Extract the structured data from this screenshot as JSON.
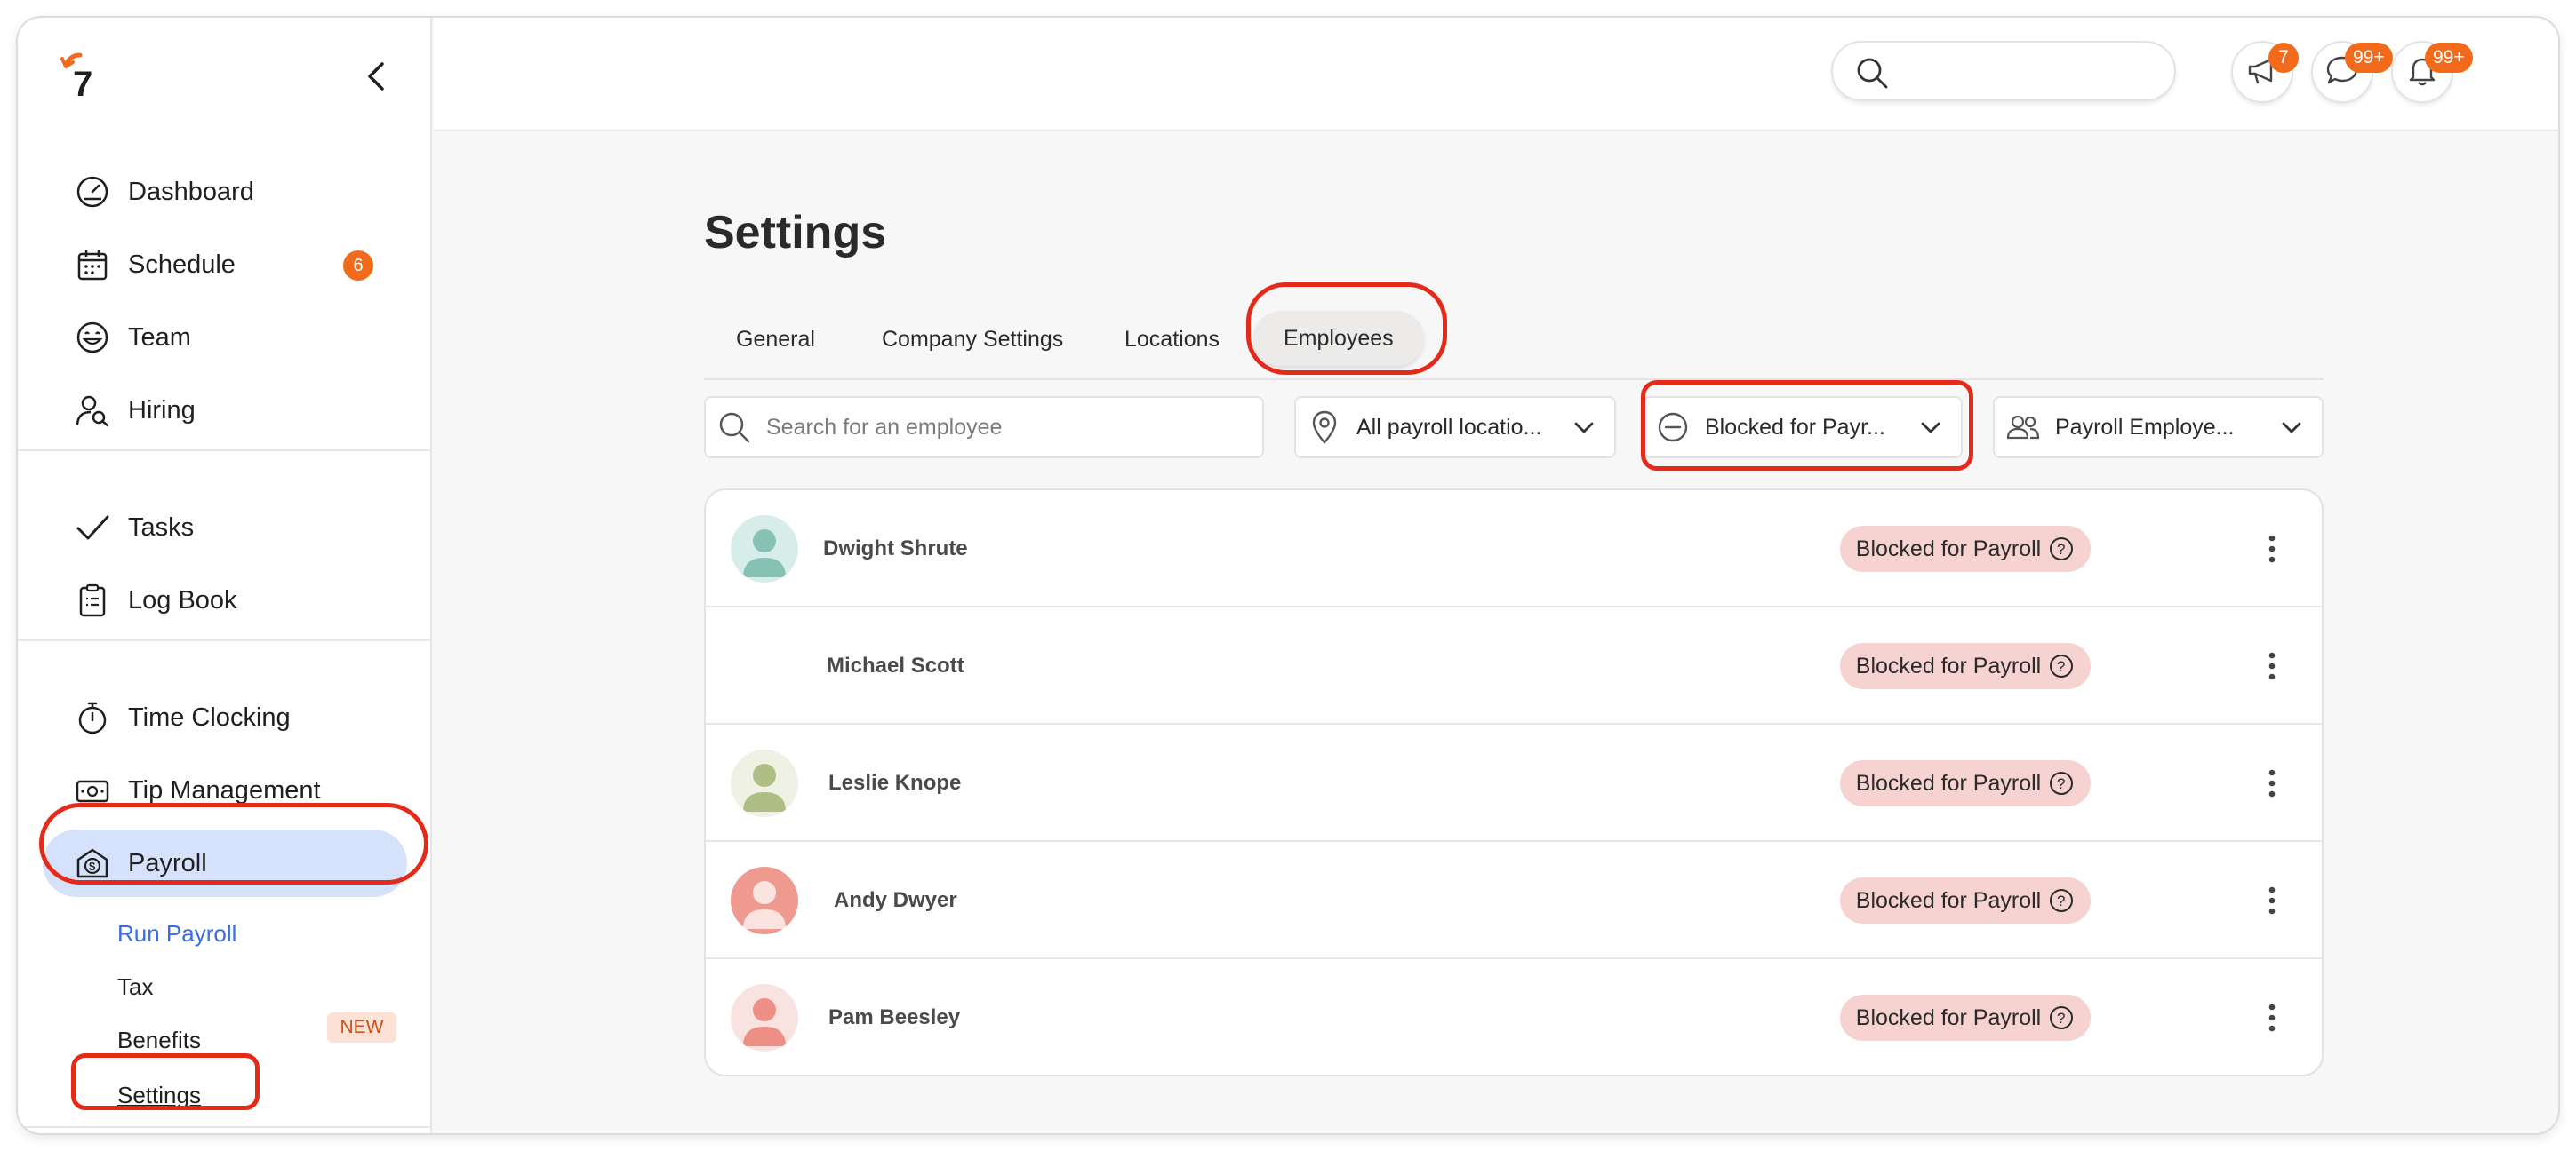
{
  "sidebar": {
    "logo_text": "7",
    "nav": [
      {
        "label": "Dashboard",
        "icon": "dashboard-gauge-icon"
      },
      {
        "label": "Schedule",
        "icon": "calendar-icon",
        "badge": "6"
      },
      {
        "label": "Team",
        "icon": "smiley-icon"
      },
      {
        "label": "Hiring",
        "icon": "person-search-icon"
      },
      {
        "label": "Tasks",
        "icon": "checkmark-icon"
      },
      {
        "label": "Log Book",
        "icon": "clipboard-icon"
      },
      {
        "label": "Time Clocking",
        "icon": "stopwatch-icon"
      },
      {
        "label": "Tip Management",
        "icon": "cash-icon"
      },
      {
        "label": "Payroll",
        "icon": "payroll-dollar-icon",
        "active": true
      }
    ],
    "payroll_sub": [
      {
        "label": "Run Payroll"
      },
      {
        "label": "Tax"
      },
      {
        "label": "Benefits",
        "badge": "NEW"
      },
      {
        "label": "Settings"
      }
    ]
  },
  "topbar": {
    "announcements_count": "7",
    "messages_count": "99+",
    "notifications_count": "99+"
  },
  "main": {
    "title": "Settings",
    "tabs": [
      "General",
      "Company Settings",
      "Locations",
      "Employees"
    ],
    "active_tab": "Employees",
    "filters": {
      "search_placeholder": "Search for an employee",
      "location": "All payroll locatio...",
      "status": "Blocked for Payr...",
      "employee_type": "Payroll Employe..."
    },
    "employees": [
      {
        "name": "Dwight Shrute",
        "status": "Blocked for Payroll"
      },
      {
        "name": "Michael Scott",
        "status": "Blocked for Payroll"
      },
      {
        "name": "Leslie Knope",
        "status": "Blocked for Payroll"
      },
      {
        "name": "Andy Dwyer",
        "status": "Blocked for Payroll"
      },
      {
        "name": "Pam Beesley",
        "status": "Blocked for Payroll"
      }
    ]
  },
  "colors": {
    "accent_orange": "#f26b1d",
    "active_nav_bg": "#d6e2fb",
    "status_badge_bg": "#f6d3d1",
    "highlight_red": "#e62a1a",
    "link_blue": "#3a6ee0"
  }
}
